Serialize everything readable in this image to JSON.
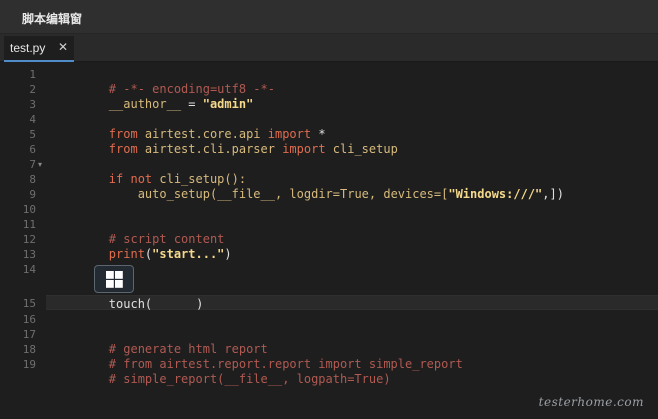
{
  "window": {
    "title": "脚本编辑窗"
  },
  "tabs": [
    {
      "label": "test.py",
      "close_icon": "✕"
    }
  ],
  "editor": {
    "line_numbers": [
      "1",
      "2",
      "3",
      "4",
      "5",
      "6",
      "7",
      "8",
      "9",
      "10",
      "11",
      "12",
      "13",
      "14",
      "15",
      "16",
      "17",
      "18",
      "19"
    ],
    "fold_markers": [
      "▾",
      "▾"
    ],
    "lines": {
      "l1": "# -*- encoding=utf8 -*-",
      "l2_a": "__author__",
      "l2_b": " = ",
      "l2_c": "\"admin\"",
      "l4_a": "from",
      "l4_b": " airtest.core.api ",
      "l4_c": "import",
      "l4_d": " *",
      "l5_a": "from",
      "l5_b": " airtest.cli.parser ",
      "l5_c": "import",
      "l5_d": " cli_setup",
      "l7_a": "if",
      "l7_b": " not",
      "l7_c": " cli_setup():",
      "l8_a": "    auto_setup(",
      "l8_b": "__file__",
      "l8_c": ", logdir=True, devices=[",
      "l8_d": "\"Windows:///\"",
      "l8_e": ",])",
      "l11": "# script content",
      "l12_a": "print",
      "l12_b": "(",
      "l12_c": "\"start...\"",
      "l12_d": ")",
      "l14_a": "touch(",
      "l14_b": ")",
      "l17": "# generate html report",
      "l18": "# from airtest.report.report import simple_report",
      "l19": "# simple_report(__file__, logpath=True)"
    },
    "image_icon": "windows-logo-icon"
  },
  "watermark": "testerhome.com",
  "colors": {
    "background": "#1e1e1e",
    "comment": "#b05a52",
    "keyword": "#e06c4f",
    "string": "#f5d98b",
    "tab_underline": "#4f8cc9"
  }
}
